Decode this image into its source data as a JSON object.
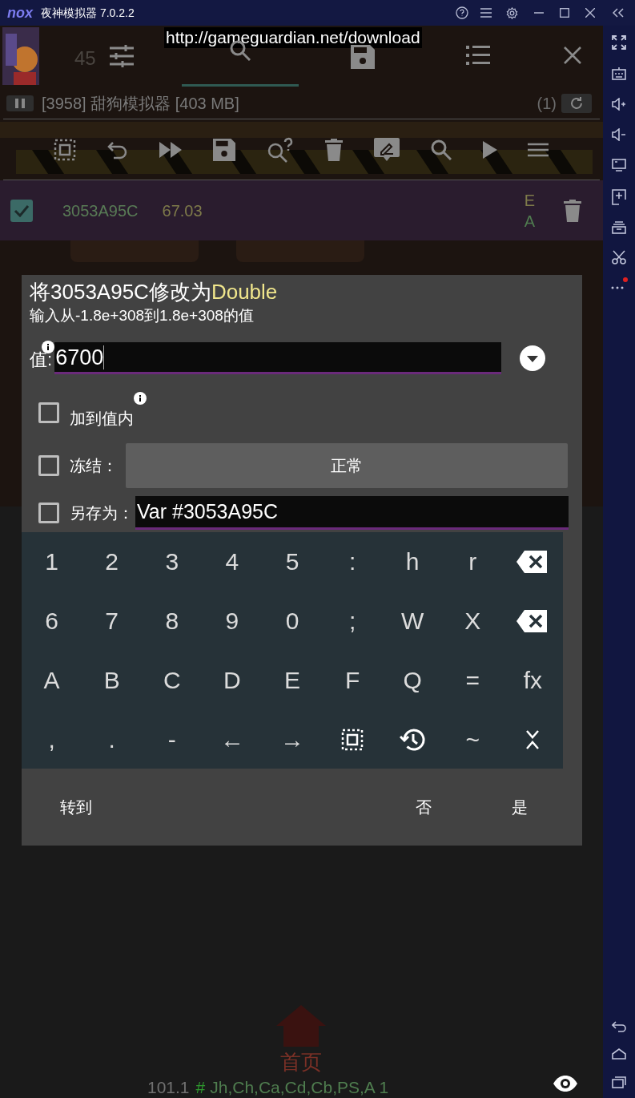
{
  "window": {
    "logo": "nox",
    "title": "夜神模拟器 7.0.2.2"
  },
  "banner": "http://gameguardian.net/download",
  "game": {
    "score": "45",
    "home_label": "首页"
  },
  "tabs": [
    {
      "selected": true
    },
    {
      "selected": false
    }
  ],
  "process": {
    "label": "[3958] 甜狗模拟器 [403 MB]",
    "count": "(1)"
  },
  "result": {
    "checked": true,
    "address": "3053A95C",
    "value": "67.03",
    "flag_1": "E",
    "flag_2": "A"
  },
  "dialog": {
    "title": "将3053A95C修改为",
    "type": "Double",
    "hint": "输入从-1.8e+308到1.8e+308的值",
    "value_label": "值:",
    "value": "6700",
    "options": [
      {
        "kind": "plain",
        "label": "加到值内",
        "checked": false
      },
      {
        "kind": "button",
        "label": "冻结：",
        "checked": false,
        "button": "正常"
      },
      {
        "kind": "field",
        "label": "另存为：",
        "checked": false,
        "value": "Var #3053A95C"
      }
    ],
    "keys": [
      [
        {
          "kind": "char",
          "label": "1"
        },
        {
          "kind": "char",
          "label": "2"
        },
        {
          "kind": "char",
          "label": "3"
        },
        {
          "kind": "char",
          "label": "4"
        },
        {
          "kind": "char",
          "label": "5"
        },
        {
          "kind": "char",
          "label": ":"
        },
        {
          "kind": "char",
          "label": "h"
        },
        {
          "kind": "char",
          "label": "r"
        },
        {
          "kind": "delete"
        }
      ],
      [
        {
          "kind": "char",
          "label": "6"
        },
        {
          "kind": "char",
          "label": "7"
        },
        {
          "kind": "char",
          "label": "8"
        },
        {
          "kind": "char",
          "label": "9"
        },
        {
          "kind": "char",
          "label": "0"
        },
        {
          "kind": "char",
          "label": ";"
        },
        {
          "kind": "char",
          "label": "W"
        },
        {
          "kind": "char",
          "label": "X"
        },
        {
          "kind": "delete"
        }
      ],
      [
        {
          "kind": "char",
          "label": "A"
        },
        {
          "kind": "char",
          "label": "B"
        },
        {
          "kind": "char",
          "label": "C"
        },
        {
          "kind": "char",
          "label": "D"
        },
        {
          "kind": "char",
          "label": "E"
        },
        {
          "kind": "char",
          "label": "F"
        },
        {
          "kind": "char",
          "label": "Q"
        },
        {
          "kind": "char",
          "label": "="
        },
        {
          "kind": "char",
          "label": "fx"
        }
      ],
      [
        {
          "kind": "char",
          "label": ","
        },
        {
          "kind": "char",
          "label": "."
        },
        {
          "kind": "char",
          "label": "-"
        },
        {
          "kind": "char",
          "label": "←"
        },
        {
          "kind": "char",
          "label": "→"
        },
        {
          "kind": "select"
        },
        {
          "kind": "history"
        },
        {
          "kind": "char",
          "label": "~"
        },
        {
          "kind": "hide"
        }
      ]
    ],
    "buttons": {
      "goto": "转到",
      "no": "否",
      "yes": "是"
    }
  },
  "status_bar": {
    "version": "101.1",
    "hash": "#",
    "flags": "Jh,Ch,Ca,Cd,Cb,PS,A 1"
  }
}
